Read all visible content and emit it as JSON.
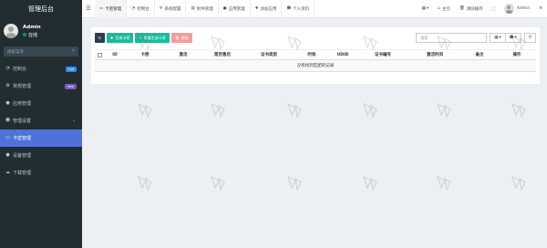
{
  "sidebar": {
    "logo": "管理后台",
    "user": {
      "name": "Admin",
      "status": "在线"
    },
    "search_placeholder": "搜索菜单",
    "items": [
      {
        "label": "控制台",
        "icon": "dashboard-icon",
        "badge": "hot",
        "badge_color": "#2c8ef8"
      },
      {
        "label": "常规管理",
        "icon": "cogs-icon",
        "badge": "new",
        "badge_color": "#7e57c2"
      },
      {
        "label": "应用管理",
        "icon": "circle-icon"
      },
      {
        "label": "管理设置",
        "icon": "user-icon",
        "chevron": "‹"
      },
      {
        "label": "卡密管理",
        "icon": "card-icon",
        "active": true
      },
      {
        "label": "设备管理",
        "icon": "apple-icon"
      },
      {
        "label": "下载管理",
        "icon": "cloud-icon"
      }
    ]
  },
  "header": {
    "tabs": [
      {
        "label": "卡密管理",
        "icon": "card-icon",
        "active": true
      },
      {
        "label": "控制台",
        "icon": "dashboard-icon"
      },
      {
        "label": "系统配置",
        "icon": "gear-icon"
      },
      {
        "label": "附件管理",
        "icon": "file-icon"
      },
      {
        "label": "应用管理",
        "icon": "circle-icon"
      },
      {
        "label": "添加应用",
        "icon": "plus-icon"
      },
      {
        "label": "个人资料",
        "icon": "user-icon"
      }
    ],
    "grid_btn": "▦",
    "home_label": "主页",
    "clear_cache_label": "清除缓存",
    "fullscreen_icon": "⛶",
    "admin_name": "Admin"
  },
  "toolbar": {
    "refresh_icon": "↻",
    "generate_label": "生成卡密",
    "batch_label": "批量生成卡密",
    "delete_label": "删除",
    "search_placeholder": "搜索"
  },
  "table": {
    "columns": [
      "ID",
      "卡密",
      "激活",
      "是否售后",
      "证书类型",
      "时效",
      "UDID",
      "证书编号",
      "激活时间",
      "备注",
      "操作"
    ],
    "empty_text": "没有找到匹配的记录"
  }
}
